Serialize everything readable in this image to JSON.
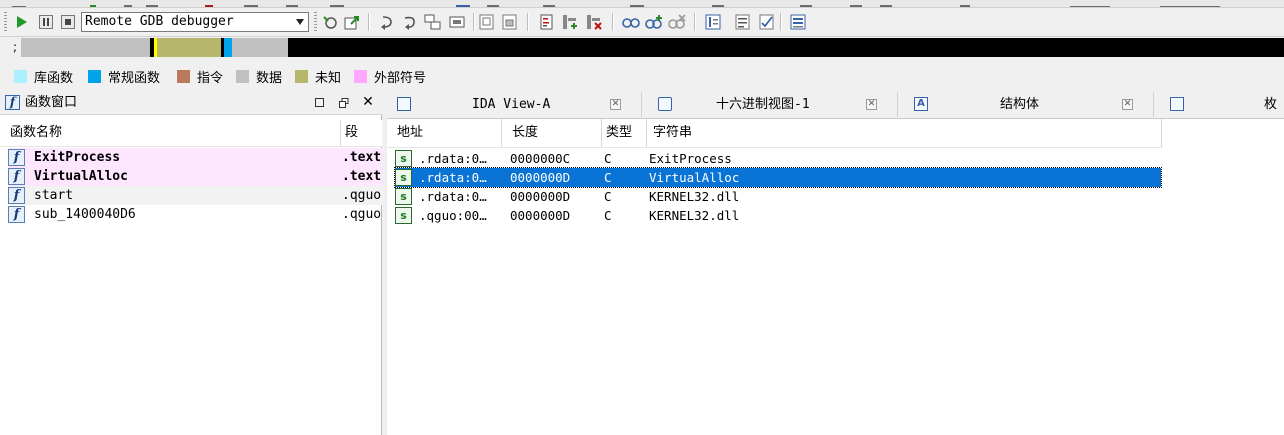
{
  "toolbar": {
    "debugger": "Remote GDB debugger"
  },
  "navband": {
    "prefix": ";"
  },
  "legend": [
    {
      "label": "库函数",
      "color": "#aaf0ff"
    },
    {
      "label": "常规函数",
      "color": "#00a3e8"
    },
    {
      "label": "指令",
      "color": "#b97a5b"
    },
    {
      "label": "数据",
      "color": "#c0c0c0"
    },
    {
      "label": "未知",
      "color": "#b7b76c"
    },
    {
      "label": "外部符号",
      "color": "#ffa8ff"
    }
  ],
  "functions_window": {
    "title": "函数窗口",
    "columns": [
      "函数名称",
      "段"
    ],
    "rows": [
      {
        "name": "ExitProcess",
        "segment": ".text"
      },
      {
        "name": "VirtualAlloc",
        "segment": ".text"
      },
      {
        "name": "start",
        "segment": ".qguo"
      },
      {
        "name": "sub_1400040D6",
        "segment": ".qguo"
      }
    ]
  },
  "tabs": [
    {
      "label": "IDA View-A"
    },
    {
      "label": "十六进制视图-1"
    },
    {
      "label": "结构体"
    },
    {
      "label": "枚举"
    }
  ],
  "strings_view": {
    "columns": [
      "地址",
      "长度",
      "类型",
      "字符串"
    ],
    "rows": [
      {
        "address": ".rdata:0…",
        "length": "0000000C",
        "type": "C",
        "string": "ExitProcess"
      },
      {
        "address": ".rdata:0…",
        "length": "0000000D",
        "type": "C",
        "string": "VirtualAlloc"
      },
      {
        "address": ".rdata:0…",
        "length": "0000000D",
        "type": "C",
        "string": "KERNEL32.dll"
      },
      {
        "address": ".qguo:00…",
        "length": "0000000D",
        "type": "C",
        "string": "KERNEL32.dll"
      }
    ],
    "selected_index": 1
  },
  "icons": {
    "function": "f",
    "string": "s"
  }
}
